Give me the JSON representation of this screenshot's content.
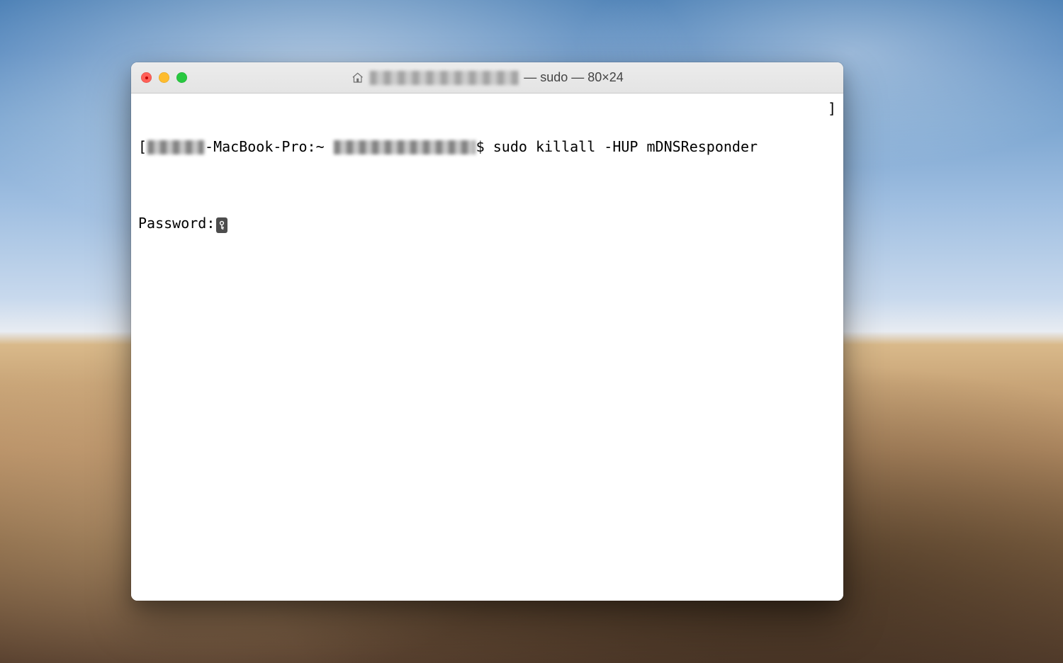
{
  "window": {
    "title_suffix": " — sudo — 80×24"
  },
  "terminal": {
    "line1": {
      "open_bracket": "[",
      "host_part": "-MacBook-Pro:~ ",
      "prompt_symbol": "$ ",
      "command": "sudo killall -HUP mDNSResponder",
      "close_bracket": "]"
    },
    "line2": {
      "label": "Password:"
    }
  }
}
